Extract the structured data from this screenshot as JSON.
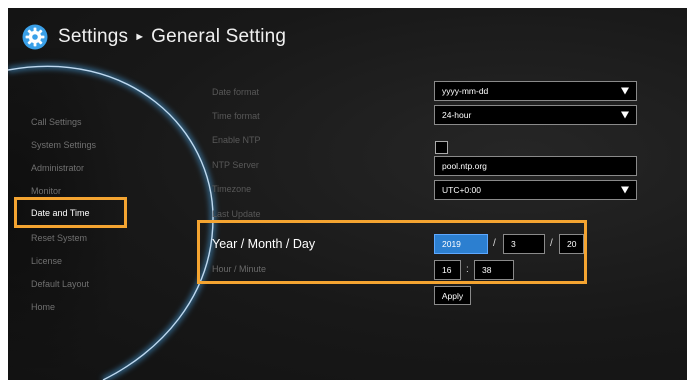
{
  "header": {
    "title": "Settings",
    "separator": "►",
    "subtitle": "General Setting",
    "icon": "gear-icon"
  },
  "sidebar": {
    "items": [
      {
        "label": "Call Settings"
      },
      {
        "label": "System Settings"
      },
      {
        "label": "Administrator"
      },
      {
        "label": "Monitor"
      },
      {
        "label": "Date and Time",
        "selected": true
      },
      {
        "label": "Reset System"
      },
      {
        "label": "License"
      },
      {
        "label": "Default Layout"
      },
      {
        "label": "Home"
      }
    ]
  },
  "form": {
    "date_format": {
      "label": "Date format",
      "value": "yyyy-mm-dd"
    },
    "time_format": {
      "label": "Time format",
      "value": "24-hour"
    },
    "enable_ntp": {
      "label": "Enable NTP",
      "checked": false
    },
    "ntp_server": {
      "label": "NTP Server",
      "value": "pool.ntp.org"
    },
    "timezone": {
      "label": "Timezone",
      "value": "UTC+0:00"
    },
    "last_update": {
      "label": "Last Update"
    },
    "date": {
      "label": "Year / Month / Day",
      "year": "2019",
      "month": "3",
      "day": "20",
      "sep": "/"
    },
    "time": {
      "label": "Hour / Minute",
      "hour": "16",
      "minute": "38",
      "sep": ":"
    },
    "apply_label": "Apply"
  },
  "colors": {
    "highlight": "#f4a431",
    "accent_blue": "#2c7fd0",
    "arc_glow": "#4fb6ff"
  }
}
